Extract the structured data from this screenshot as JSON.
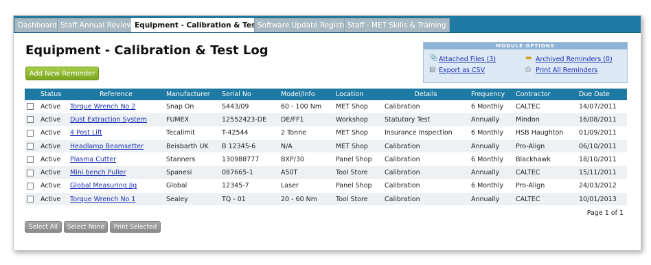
{
  "tabs": [
    {
      "label": "Dashboard"
    },
    {
      "label": "Staff Annual Reviews"
    },
    {
      "label": "Equipment - Calibration & Test Log"
    },
    {
      "label": "Software Update Register"
    },
    {
      "label": "Staff - MET Skills & Training"
    }
  ],
  "active_tab": "Equipment - Calibration & Test Log",
  "page_title": "Equipment - Calibration & Test Log",
  "add_button": "Add New Reminder",
  "module_options": {
    "heading": "MODULE OPTIONS",
    "attached_files": "Attached Files (3)",
    "archived_reminders": "Archived Reminders (0)",
    "export_csv": "Export as CSV",
    "print_all": "Print All Reminders"
  },
  "table": {
    "headers": [
      "Status",
      "Reference",
      "Manufacturer",
      "Serial No",
      "Model/Info",
      "Location",
      "Details",
      "Frequency",
      "Contractor",
      "Due Date"
    ],
    "rows": [
      {
        "status": "Active",
        "reference": "Torque Wrench No 2",
        "manufacturer": "Snap On",
        "serial": "S443/09",
        "model": "60 - 100 Nm",
        "location": "MET Shop",
        "details": "Calibration",
        "frequency": "6 Monthly",
        "contractor": "CALTEC",
        "due": "14/07/2011"
      },
      {
        "status": "Active",
        "reference": "Dust Extraction System",
        "manufacturer": "FUMEX",
        "serial": "12552423-DE",
        "model": "DE/FF1",
        "location": "Workshop",
        "details": "Statutory Test",
        "frequency": "Annually",
        "contractor": "Mindon",
        "due": "16/08/2011"
      },
      {
        "status": "Active",
        "reference": "4 Post Lift",
        "manufacturer": "Tecalimit",
        "serial": "T-42544",
        "model": "2 Tonne",
        "location": "MET Shop",
        "details": "Insurance Inspection",
        "frequency": "6 Monthly",
        "contractor": "HSB Haughton",
        "due": "01/09/2011"
      },
      {
        "status": "Active",
        "reference": "Headlamp Beamsetter",
        "manufacturer": "Beisbarth UK",
        "serial": "B 12345-6",
        "model": "N/A",
        "location": "MET Shop",
        "details": "Calibration",
        "frequency": "Annually",
        "contractor": "Pro-Align",
        "due": "06/10/2011"
      },
      {
        "status": "Active",
        "reference": "Plasma Cutter",
        "manufacturer": "Stanners",
        "serial": "130988777",
        "model": "BXP/30",
        "location": "Panel Shop",
        "details": "Calibration",
        "frequency": "6 Monthly",
        "contractor": "Blackhawk",
        "due": "18/10/2011"
      },
      {
        "status": "Active",
        "reference": "Mini bench Puller",
        "manufacturer": "Spanesi",
        "serial": "087665-1",
        "model": "A50T",
        "location": "Tool Store",
        "details": "Calibration",
        "frequency": "Annually",
        "contractor": "CALTEC",
        "due": "15/11/2011"
      },
      {
        "status": "Active",
        "reference": "Global Measuring Jig",
        "manufacturer": "Global",
        "serial": "12345-7",
        "model": "Laser",
        "location": "Panel Shop",
        "details": "Calibration",
        "frequency": "6 Monthly",
        "contractor": "Pro-Align",
        "due": "24/03/2012"
      },
      {
        "status": "Active",
        "reference": "Torque Wrench No 1",
        "manufacturer": "Sealey",
        "serial": "TQ - 01",
        "model": "20 - 60 Nm",
        "location": "Tool Store",
        "details": "Calibration",
        "frequency": "Annually",
        "contractor": "CALTEC",
        "due": "10/01/2013"
      }
    ]
  },
  "pager": "Page 1 of 1",
  "bottom_buttons": {
    "select_all": "Select All",
    "select_none": "Select None",
    "print_selected": "Print Selected"
  }
}
